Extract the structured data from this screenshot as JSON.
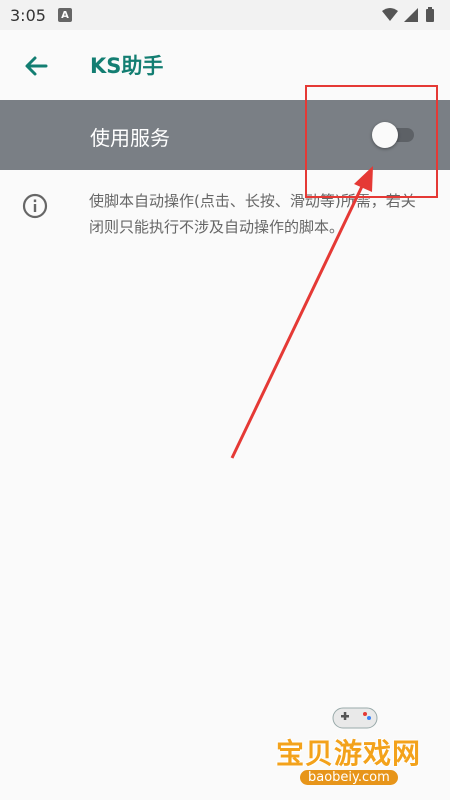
{
  "status_bar": {
    "time": "3:05",
    "notification_icon_letter": "A",
    "icons": [
      "notification-a-icon",
      "wifi-icon",
      "signal-icon",
      "battery-icon"
    ]
  },
  "app_bar": {
    "back_icon": "arrow-back-icon",
    "title": "KS助手",
    "accent_color": "#137e72"
  },
  "main_switch": {
    "label": "使用服务",
    "state": "off",
    "background_color": "#7a7f85"
  },
  "info": {
    "icon": "info-icon",
    "description": "使脚本自动操作(点击、长按、滑动等)所需，若关闭则只能执行不涉及自动操作的脚本。"
  },
  "annotation": {
    "color": "#e53935"
  },
  "watermark": {
    "title": "宝贝游戏网",
    "url": "baobeiy.com"
  }
}
